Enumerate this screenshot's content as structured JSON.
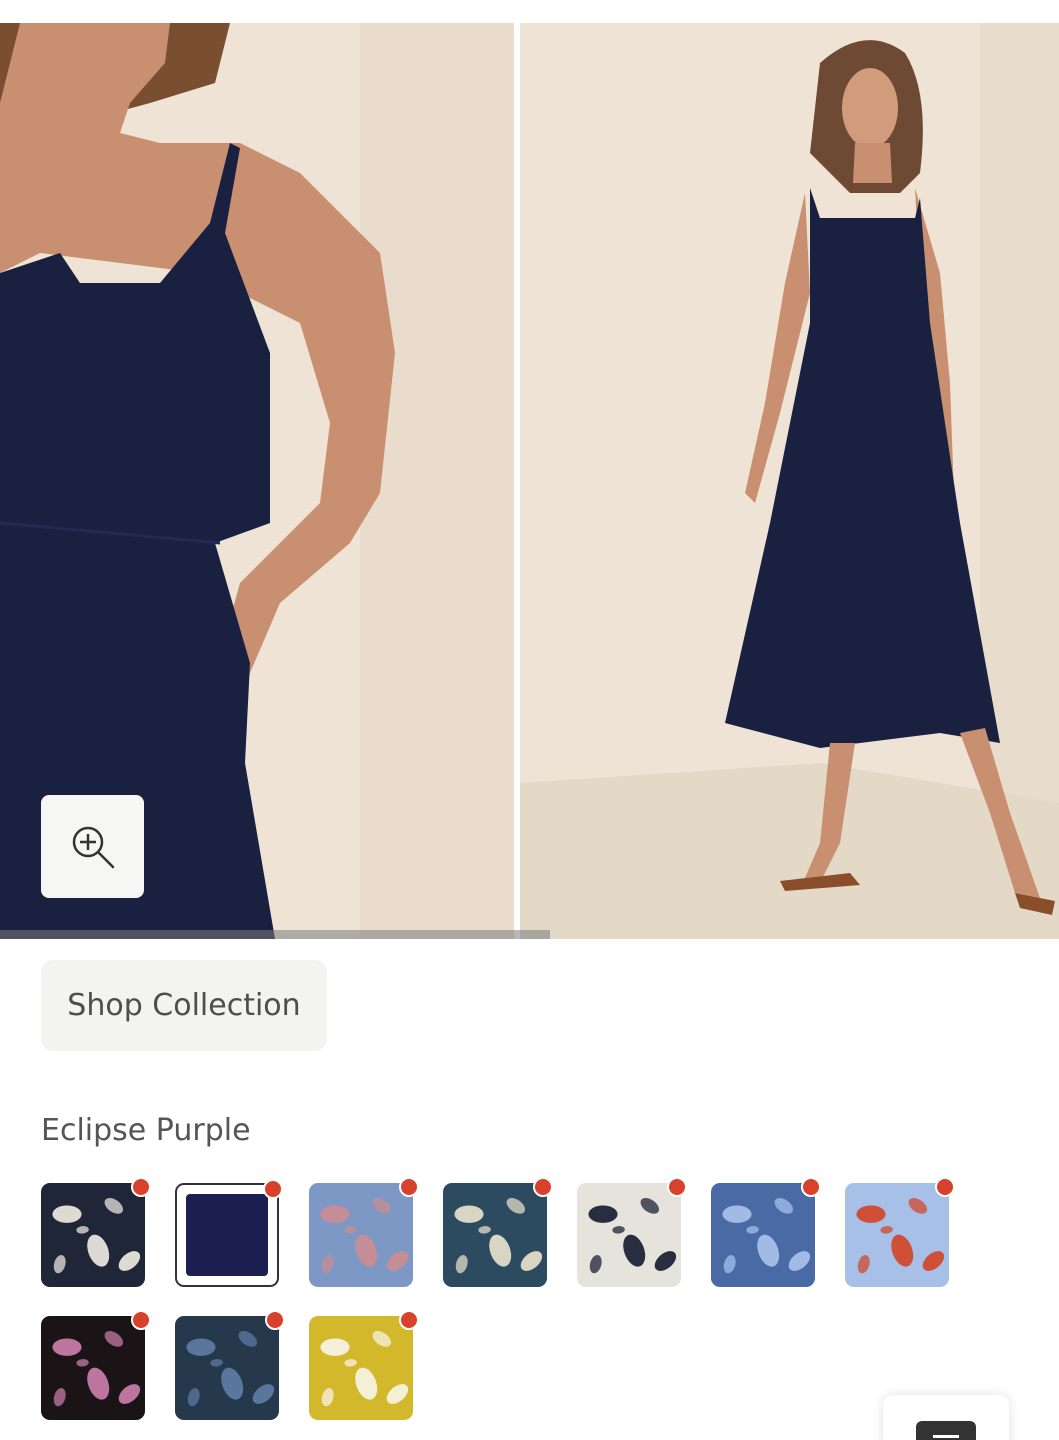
{
  "gallery": {
    "images": [
      {
        "alt_icon": "detail-photo"
      },
      {
        "alt_icon": "full-length-photo"
      }
    ],
    "zoom_icon": "zoom-in-icon"
  },
  "actions": {
    "shop_collection_label": "Shop Collection"
  },
  "color_selector": {
    "selected_name": "Eclipse Purple",
    "swatches": [
      {
        "name": "navy-floral",
        "base": "#1e2638",
        "accent": "#e8e4dc"
      },
      {
        "name": "eclipse-purple",
        "base": "#1c2050",
        "accent": "#1c2050",
        "selected": true
      },
      {
        "name": "blue-rose",
        "base": "#7d98c4",
        "accent": "#c98c93"
      },
      {
        "name": "teal-line-floral",
        "base": "#2c4a60",
        "accent": "#e2dcc8"
      },
      {
        "name": "palm-leaf",
        "base": "#e6e2dc",
        "accent": "#1d2336"
      },
      {
        "name": "blue-ditsy",
        "base": "#4a6aa6",
        "accent": "#a6c0e8"
      },
      {
        "name": "sky-floral",
        "base": "#a6c0e8",
        "accent": "#d04a2e"
      },
      {
        "name": "black-floral",
        "base": "#1a1416",
        "accent": "#c47aa6"
      },
      {
        "name": "midnight-bloom",
        "base": "#26384c",
        "accent": "#5c7aa0"
      },
      {
        "name": "citrine-leaf",
        "base": "#d4b82c",
        "accent": "#f6f2e2"
      }
    ],
    "badge_color": "#d8412c"
  },
  "colors": {
    "dress": "#1a2040",
    "wall": "#efe3d6",
    "floor": "#e3d9c6"
  }
}
